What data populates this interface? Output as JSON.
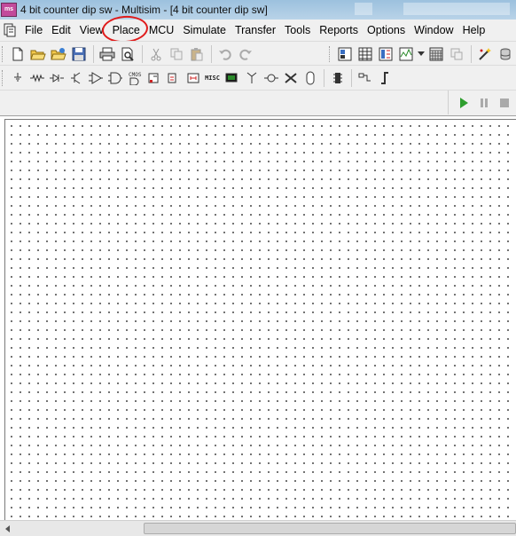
{
  "window": {
    "title": "4 bit counter dip sw - Multisim - [4 bit counter dip sw]",
    "app_icon_text": "ms"
  },
  "menu": {
    "items": [
      {
        "label": "File"
      },
      {
        "label": "Edit"
      },
      {
        "label": "View"
      },
      {
        "label": "Place"
      },
      {
        "label": "MCU"
      },
      {
        "label": "Simulate"
      },
      {
        "label": "Transfer"
      },
      {
        "label": "Tools"
      },
      {
        "label": "Reports"
      },
      {
        "label": "Options"
      },
      {
        "label": "Window"
      },
      {
        "label": "Help"
      }
    ],
    "highlighted_item": "Place",
    "highlight_color": "#e01b1b"
  },
  "toolbar_standard": {
    "icons": [
      "new-icon",
      "open-icon",
      "open-samples-icon",
      "save-icon",
      "print-icon",
      "print-preview-icon",
      "cut-icon",
      "copy-icon",
      "paste-icon",
      "undo-icon",
      "redo-icon"
    ]
  },
  "toolbar_view": {
    "icons": [
      "design-toolbox-icon",
      "spreadsheet-icon",
      "breadboard-icon",
      "grapher-icon",
      "dropdown-icon",
      "postprocessor-icon",
      "ercs-icon",
      "component-wizard-icon",
      "database-icon"
    ]
  },
  "toolbar_components": {
    "labels": {
      "misc": "MISC",
      "cmos": "CMOS"
    }
  },
  "simulation": {
    "run_color": "#2e9e2e"
  }
}
